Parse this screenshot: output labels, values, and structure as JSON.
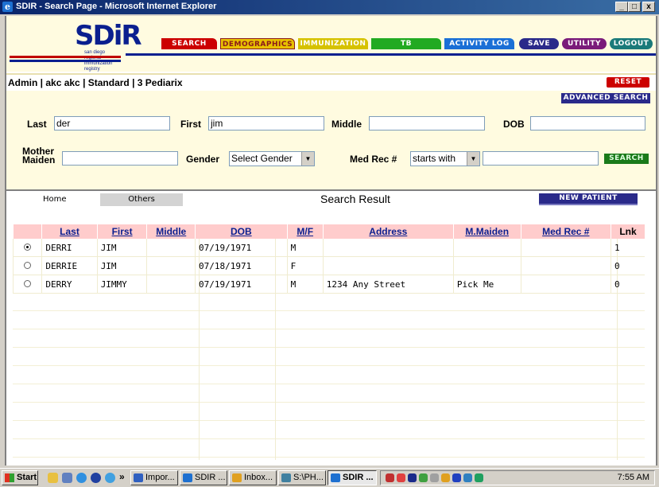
{
  "window": {
    "title": "SDIR - Search Page - Microsoft Internet Explorer",
    "controls": [
      "_",
      "□",
      "x"
    ]
  },
  "logo": {
    "text": "SDiR",
    "subtitle": "san diego regional immunization registry"
  },
  "nav": {
    "search": "SEARCH",
    "demographics": "DEMOGRAPHICS",
    "immunization": "IMMUNIZATION",
    "tb": "TB",
    "activity_log": "ACTIVITY LOG",
    "save": "SAVE",
    "utility": "UTILITY",
    "logout": "LOGOUT"
  },
  "userbar": {
    "info": "Admin | akc akc | Standard | 3 Pediarix",
    "reset": "RESET",
    "advanced_search": "ADVANCED SEARCH"
  },
  "form": {
    "last_label": "Last",
    "last_value": "der",
    "first_label": "First",
    "first_value": "jim",
    "middle_label": "Middle",
    "middle_value": "",
    "dob_label": "DOB",
    "dob_value": "",
    "mother_label_1": "Mother",
    "mother_label_2": "Maiden",
    "mother_value": "",
    "gender_label": "Gender",
    "gender_value": "Select Gender",
    "medrec_label": "Med Rec #",
    "medrec_mode": "starts with",
    "medrec_value": "",
    "search_button": "SEARCH"
  },
  "tabs": {
    "home": "Home",
    "others": "Others",
    "result_title": "Search Result",
    "new_patient": "NEW PATIENT"
  },
  "table": {
    "columns": [
      "",
      "Last",
      "First",
      "Middle",
      "DOB",
      "M/F",
      "Address",
      "M.Maiden",
      "Med Rec #",
      "Lnk"
    ],
    "rows": [
      {
        "selected": true,
        "last": "DERRI",
        "first": "JIM",
        "middle": "",
        "dob": "07/19/1971",
        "sex": "M",
        "address": "",
        "maiden": "",
        "medrec": "",
        "lnk": "1"
      },
      {
        "selected": false,
        "last": "DERRIE",
        "first": "JIM",
        "middle": "",
        "dob": "07/18/1971",
        "sex": "F",
        "address": "",
        "maiden": "",
        "medrec": "",
        "lnk": "0"
      },
      {
        "selected": false,
        "last": "DERRY",
        "first": "JIMMY",
        "middle": "",
        "dob": "07/19/1971",
        "sex": "M",
        "address": "1234 Any Street",
        "maiden": "Pick Me",
        "medrec": "",
        "lnk": "0"
      }
    ]
  },
  "taskbar": {
    "start": "Start",
    "chevron": "»",
    "items": [
      "Impor...",
      "SDIR ...",
      "Inbox...",
      "S:\\PH...",
      "SDIR ..."
    ],
    "clock": "7:55 AM"
  },
  "colors": {
    "header_bg": "#fffbe0",
    "table_header_bg": "#ffcccc",
    "search_red": "#cc0000",
    "demographics_brown": "#8b1a1a",
    "immunization_yellow": "#d6c200",
    "tb_green": "#22aa22",
    "activity_blue": "#1a6fd6",
    "save_navy": "#2a2a8a",
    "utility_purple": "#7a1a7a",
    "logout_teal": "#1a7a7a"
  }
}
